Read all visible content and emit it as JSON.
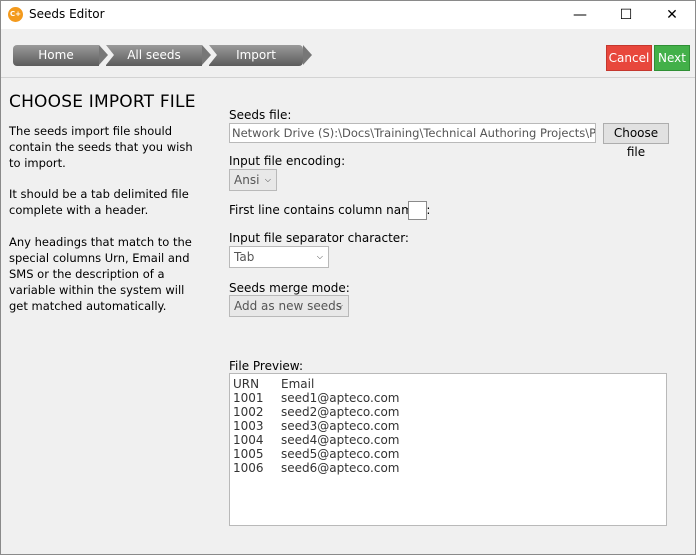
{
  "window": {
    "title": "Seeds Editor",
    "icon_text": "C+",
    "icon_color": "#f39a1d"
  },
  "breadcrumbs": [
    "Home",
    "All seeds",
    "Import"
  ],
  "actions": {
    "cancel": "Cancel",
    "next": "Next",
    "cancel_color": "#e8473c",
    "next_color": "#43b049"
  },
  "left": {
    "heading": "CHOOSE IMPORT FILE",
    "paragraphs": [
      "The seeds import file should contain the seeds that you wish to import.",
      "It should be a tab delimited file complete with a header.",
      "Any headings that match to the special columns Urn, Email and SMS or the description of a variable within the system will get matched automatically."
    ]
  },
  "form": {
    "seeds_file_label": "Seeds file:",
    "seeds_file_value": "Network Drive (S):\\Docs\\Training\\Technical Authoring Projects\\Peopl",
    "choose_file_label": "Choose file",
    "encoding_label": "Input file encoding:",
    "encoding_value": "Ansi",
    "first_line_label": "First line contains column names:",
    "first_line_checked": false,
    "separator_label": "Input file separator character:",
    "separator_value": "Tab",
    "merge_label": "Seeds merge mode:",
    "merge_value": "Add as new seeds"
  },
  "preview": {
    "label": "File Preview:",
    "header": [
      "URN",
      "Email"
    ],
    "rows": [
      [
        "1001",
        "seed1@apteco.com"
      ],
      [
        "1002",
        "seed2@apteco.com"
      ],
      [
        "1003",
        "seed3@apteco.com"
      ],
      [
        "1004",
        "seed4@apteco.com"
      ],
      [
        "1005",
        "seed5@apteco.com"
      ],
      [
        "1006",
        "seed6@apteco.com"
      ]
    ]
  }
}
